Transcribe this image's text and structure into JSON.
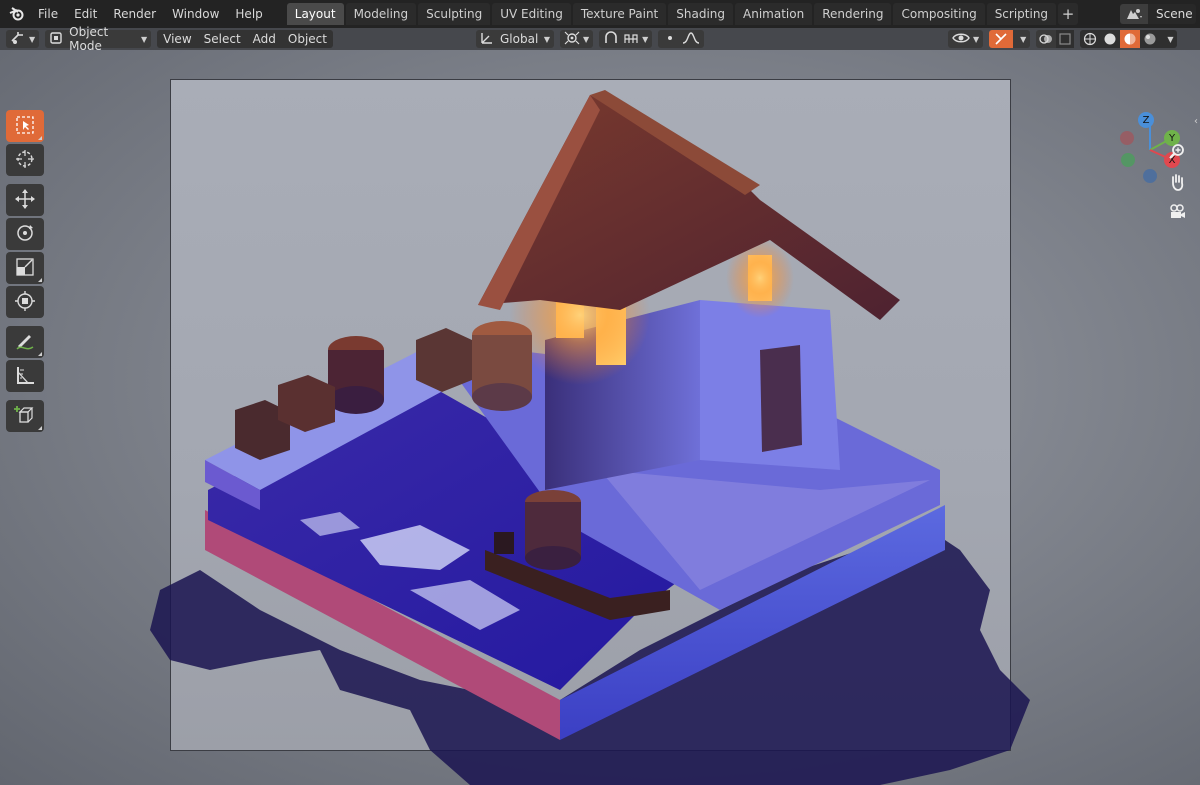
{
  "topbar": {
    "menu": [
      "File",
      "Edit",
      "Render",
      "Window",
      "Help"
    ],
    "tabs": [
      {
        "label": "Layout",
        "active": true
      },
      {
        "label": "Modeling",
        "active": false
      },
      {
        "label": "Sculpting",
        "active": false
      },
      {
        "label": "UV Editing",
        "active": false
      },
      {
        "label": "Texture Paint",
        "active": false
      },
      {
        "label": "Shading",
        "active": false
      },
      {
        "label": "Animation",
        "active": false
      },
      {
        "label": "Rendering",
        "active": false
      },
      {
        "label": "Compositing",
        "active": false
      },
      {
        "label": "Scripting",
        "active": false
      }
    ],
    "add_tab": "+",
    "scene_name": "Scene"
  },
  "header": {
    "mode": "Object Mode",
    "menus": [
      "View",
      "Select",
      "Add",
      "Object"
    ],
    "transform_orientation": "Global"
  },
  "toolbar": {
    "tools": [
      "select-box",
      "cursor",
      "move",
      "rotate",
      "scale",
      "transform",
      "annotate",
      "measure",
      "add-cube"
    ]
  },
  "colors": {
    "accent": "#e06a38",
    "axis_x": "#e0484f",
    "axis_y": "#6fb24a",
    "axis_z": "#4a8fd9"
  },
  "gizmo": {
    "x": "X",
    "y": "Y",
    "z": "Z"
  }
}
